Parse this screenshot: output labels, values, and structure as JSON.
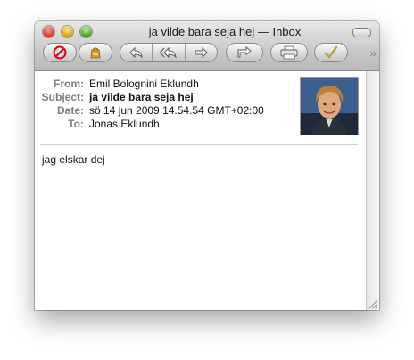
{
  "window": {
    "title": "ja vilde bara seja hej — Inbox"
  },
  "toolbar": {
    "buttons": [
      {
        "name": "delete",
        "icon": "no-entry-icon"
      },
      {
        "name": "junk",
        "icon": "junk-bag-icon"
      },
      {
        "name": "reply",
        "icon": "reply-arrow-icon"
      },
      {
        "name": "reply-all",
        "icon": "reply-all-arrow-icon"
      },
      {
        "name": "forward",
        "icon": "forward-arrow-icon"
      },
      {
        "name": "redirect",
        "icon": "redirect-arrow-icon"
      },
      {
        "name": "print",
        "icon": "printer-icon"
      },
      {
        "name": "mark",
        "icon": "checkmark-icon"
      }
    ],
    "overflow_glyph": "»"
  },
  "message": {
    "headers": [
      {
        "label": "From:",
        "value": "Emil Bolognini Eklundh"
      },
      {
        "label": "Subject:",
        "value": "ja vilde bara seja hej"
      },
      {
        "label": "Date:",
        "value": "sö 14 jun 2009 14.54.54 GMT+02:00"
      },
      {
        "label": "To:",
        "value": "Jonas Eklundh"
      }
    ],
    "body": "jag elskar dej"
  },
  "colors": {
    "close": "#d1301e",
    "minimize": "#d99b07",
    "zoom": "#3e9a18",
    "delete_icon": "#d0021b",
    "junk_icon": "#c98a1a",
    "mark_icon": "#b8a23a"
  }
}
